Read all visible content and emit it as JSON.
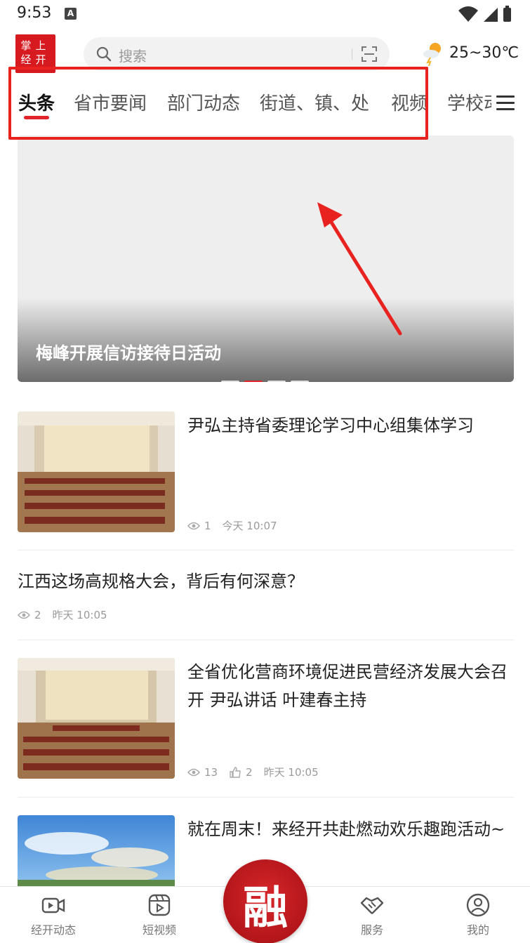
{
  "status_bar": {
    "time": "9:53",
    "notification_icon": "A"
  },
  "header": {
    "logo_text": "掌上经开",
    "search_placeholder": "搜索",
    "weather_temp": "25~30℃"
  },
  "tabs": [
    {
      "label": "头条",
      "active": true
    },
    {
      "label": "省市要闻",
      "active": false
    },
    {
      "label": "部门动态",
      "active": false
    },
    {
      "label": "街道、镇、处",
      "active": false
    },
    {
      "label": "视频",
      "active": false
    },
    {
      "label": "学校动",
      "active": false
    }
  ],
  "banner": {
    "title": "梅峰开展信访接待日活动",
    "slide_count": 4,
    "active_slide": 2
  },
  "news": [
    {
      "title": "尹弘主持省委理论学习中心组集体学习",
      "views": "1",
      "likes": null,
      "time": "今天 10:07",
      "has_thumb": true
    },
    {
      "title": "江西这场高规格大会，背后有何深意？",
      "views": "2",
      "likes": null,
      "time": "昨天 10:05",
      "has_thumb": false
    },
    {
      "title": "全省优化营商环境促进民营经济发展大会召开 尹弘讲话 叶建春主持",
      "views": "13",
      "likes": "2",
      "time": "昨天 10:05",
      "has_thumb": true
    },
    {
      "title": "就在周末！来经开共赴燃动欢乐趣跑活动~",
      "views": null,
      "likes": null,
      "time": null,
      "has_thumb": true
    }
  ],
  "bottom_nav": {
    "items": [
      {
        "label": "经开动态",
        "icon": "video-camera-icon"
      },
      {
        "label": "短视频",
        "icon": "short-video-icon"
      },
      {
        "label": "服务",
        "icon": "handshake-icon"
      },
      {
        "label": "我的",
        "icon": "user-icon"
      }
    ],
    "center_label": "融"
  },
  "colors": {
    "accent": "#e2232a",
    "annotation": "#e8231f"
  }
}
